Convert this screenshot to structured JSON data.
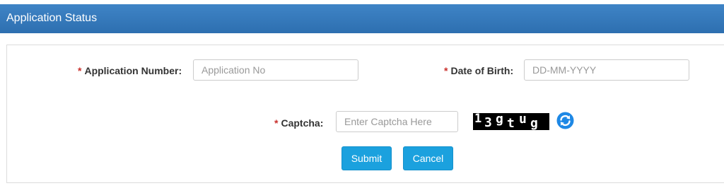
{
  "header": {
    "title": "Application Status"
  },
  "form": {
    "application_number": {
      "required_mark": "*",
      "label": "Application Number:",
      "placeholder": "Application No",
      "value": ""
    },
    "date_of_birth": {
      "required_mark": "*",
      "label": "Date of Birth:",
      "placeholder": "DD-MM-YYYY",
      "value": ""
    },
    "captcha": {
      "required_mark": "*",
      "label": "Captcha:",
      "placeholder": "Enter Captcha Here",
      "value": "",
      "image_chars": [
        "1",
        "3",
        "g",
        "t",
        "u",
        "g"
      ],
      "refresh_icon": "refresh-icon"
    }
  },
  "actions": {
    "submit_label": "Submit",
    "cancel_label": "Cancel"
  },
  "colors": {
    "header_bg": "#2d6fb0",
    "button_bg": "#1ba1de",
    "required": "#c9302c",
    "refresh_icon": "#1e88e5"
  }
}
